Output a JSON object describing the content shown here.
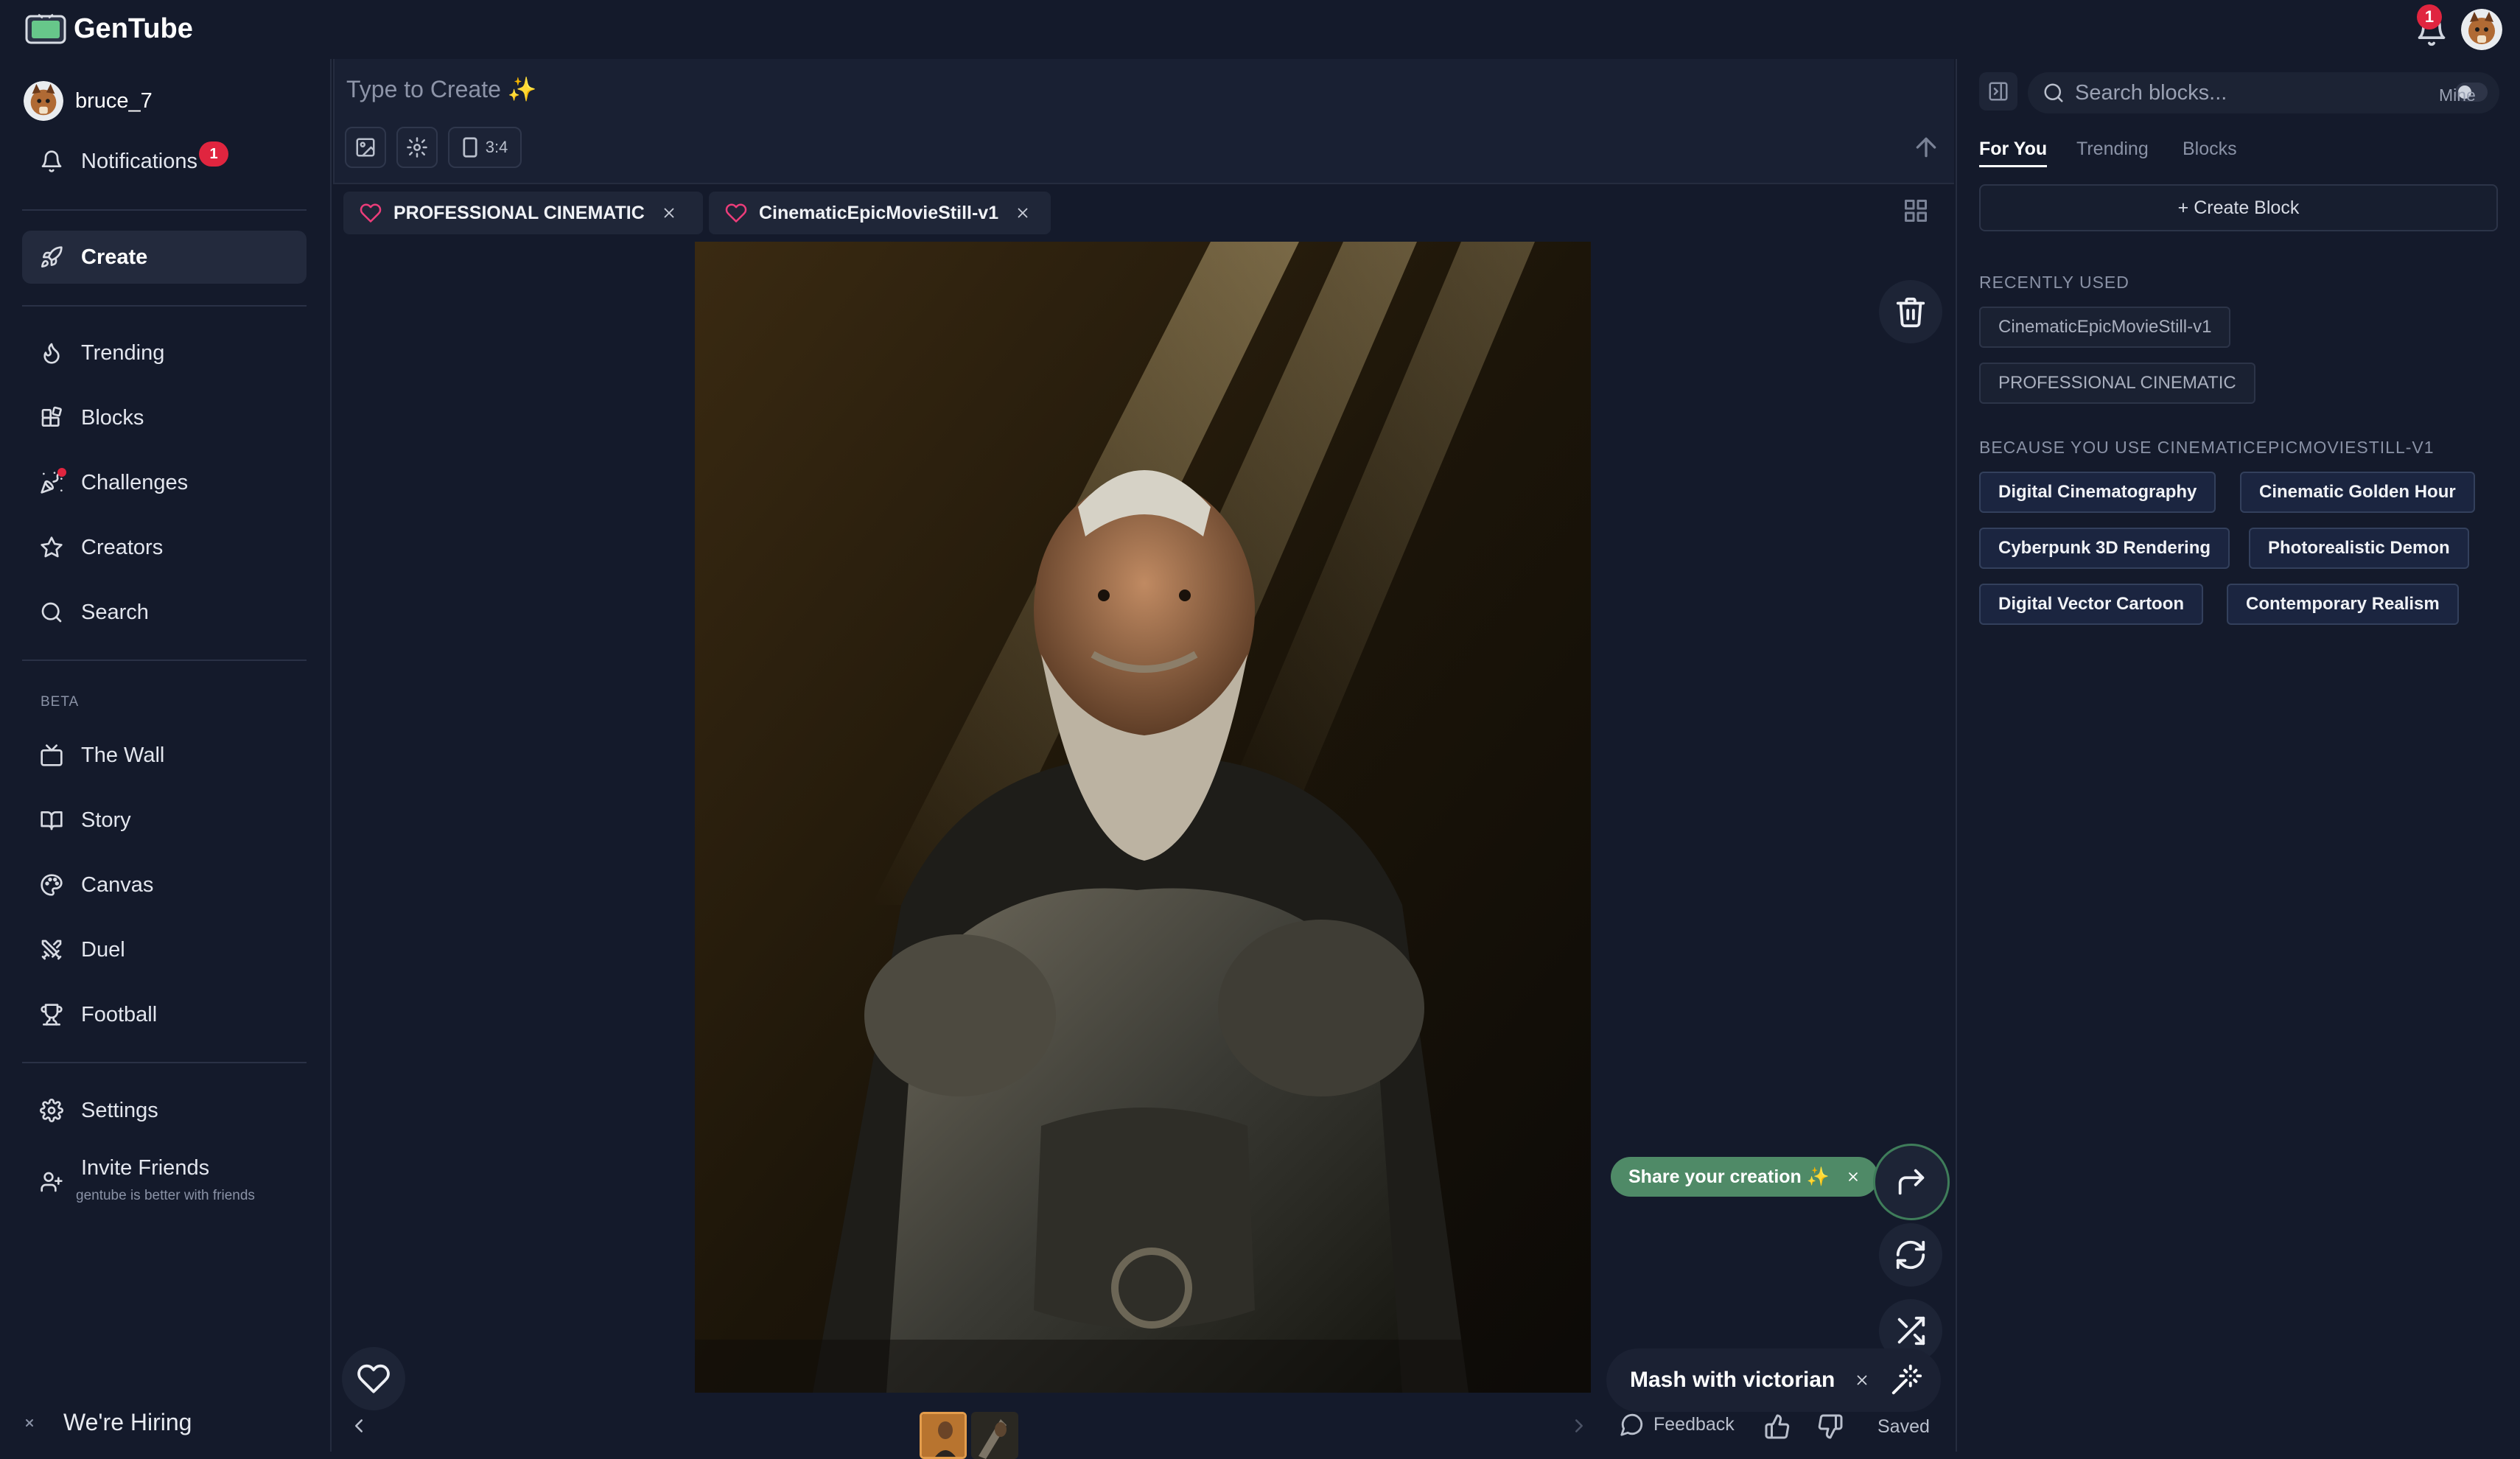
{
  "app": {
    "title": "GenTube"
  },
  "topbar": {
    "notification_count": "1"
  },
  "sidebar": {
    "user": {
      "name": "bruce_7"
    },
    "notifications": {
      "label": "Notifications",
      "count": "1"
    },
    "create": {
      "label": "Create"
    },
    "items": [
      {
        "label": "Trending"
      },
      {
        "label": "Blocks"
      },
      {
        "label": "Challenges"
      },
      {
        "label": "Creators"
      },
      {
        "label": "Search"
      }
    ],
    "beta_label": "BETA",
    "beta_items": [
      {
        "label": "The Wall"
      },
      {
        "label": "Story"
      },
      {
        "label": "Canvas"
      },
      {
        "label": "Duel"
      },
      {
        "label": "Football"
      }
    ],
    "settings": {
      "label": "Settings"
    },
    "invite": {
      "label": "Invite Friends",
      "subtitle": "gentube is better with friends"
    },
    "hiring": {
      "label": "We're Hiring"
    }
  },
  "prompt": {
    "placeholder": "Type to Create ✨",
    "aspect_ratio": "3:4"
  },
  "chips": [
    {
      "label": "PROFESSIONAL CINEMATIC"
    },
    {
      "label": "CinematicEpicMovieStill-v1"
    }
  ],
  "actions": {
    "share_label": "Share your creation ✨",
    "mash_label": "Mash with victorian"
  },
  "bottom": {
    "feedback_label": "Feedback",
    "saved_label": "Saved"
  },
  "right_panel": {
    "search_placeholder": "Search blocks...",
    "mine_label": "Mine",
    "tabs": [
      {
        "label": "For You"
      },
      {
        "label": "Trending"
      },
      {
        "label": "Blocks"
      }
    ],
    "create_block_label": "+ Create Block",
    "recent_heading": "RECENTLY USED",
    "recent": [
      {
        "label": "CinematicEpicMovieStill-v1"
      },
      {
        "label": "PROFESSIONAL CINEMATIC"
      }
    ],
    "because_heading": "BECAUSE YOU USE CINEMATICEPICMOVIESTILL-V1",
    "suggestions": [
      {
        "label": "Digital Cinematography"
      },
      {
        "label": "Cinematic Golden Hour"
      },
      {
        "label": "Cyberpunk 3D Rendering"
      },
      {
        "label": "Photorealistic Demon"
      },
      {
        "label": "Digital Vector Cartoon"
      },
      {
        "label": "Contemporary Realism"
      }
    ]
  },
  "colors": {
    "background": "#141a2b",
    "accent_badge": "#e0253f",
    "share_green": "#4f8a67",
    "heart_pink": "#ec3d7a"
  }
}
